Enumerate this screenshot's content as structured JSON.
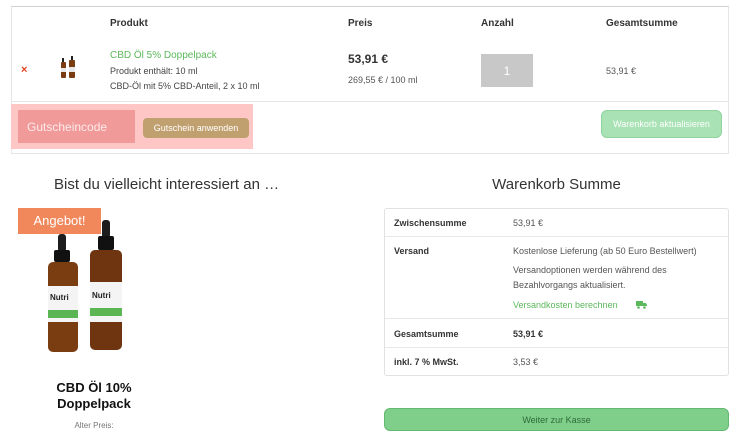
{
  "table": {
    "headers": {
      "product": "Produkt",
      "price": "Preis",
      "quantity": "Anzahl",
      "total": "Gesamtsumme"
    }
  },
  "cart_item": {
    "remove_symbol": "×",
    "name": "CBD Öl 5% Doppelpack",
    "content": "Produkt enthält: 10 ml",
    "description": "CBD-Öl mit 5% CBD-Anteil, 2 x 10 ml",
    "price": "53,91 €",
    "unit_price": "269,55 € / 100 ml",
    "quantity": "1",
    "total": "53,91 €"
  },
  "coupon": {
    "placeholder": "Gutscheincode",
    "apply_label": "Gutschein anwenden"
  },
  "update_cart_label": "Warenkorb aktualisieren",
  "cross_sells": {
    "title": "Bist du vielleicht interessiert an …",
    "badge": "Angebot!",
    "product_name": "CBD Öl 10% Doppelpack",
    "old_price_label": "Alter Preis:"
  },
  "totals": {
    "title": "Warenkorb Summe",
    "subtotal_label": "Zwischensumme",
    "subtotal_value": "53,91 €",
    "shipping_label": "Versand",
    "shipping_value": "Kostenlose Lieferung (ab 50 Euro Bestellwert)",
    "shipping_note_1": "Versandoptionen werden während des",
    "shipping_note_2": "Bezahlvorgangs aktualisiert.",
    "shipping_calc_link": "Versandkosten berechnen",
    "total_label": "Gesamtsumme",
    "total_value": "53,91 €",
    "tax_label": "inkl. 7 % MwSt.",
    "tax_value": "3,53 €"
  },
  "checkout_label": "Weiter zur Kasse",
  "colors": {
    "accent_green": "#5cb85c",
    "remove_red": "#e2401c",
    "coupon_highlight": "#ffc6c6",
    "sale_badge": "#f0885c",
    "checkout_green": "#7fcf8b"
  }
}
